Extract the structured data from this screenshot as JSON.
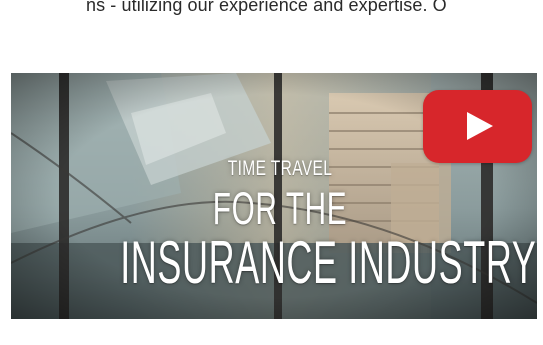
{
  "intro": {
    "text": "ns - utilizing our experience and expertise. O"
  },
  "video": {
    "title_small": "TIME TRAVEL",
    "title_mid": "FOR THE",
    "title_big": "INSURANCE INDUSTRY",
    "play_icon": "youtube-play-icon",
    "accent_color": "#d7262b"
  }
}
